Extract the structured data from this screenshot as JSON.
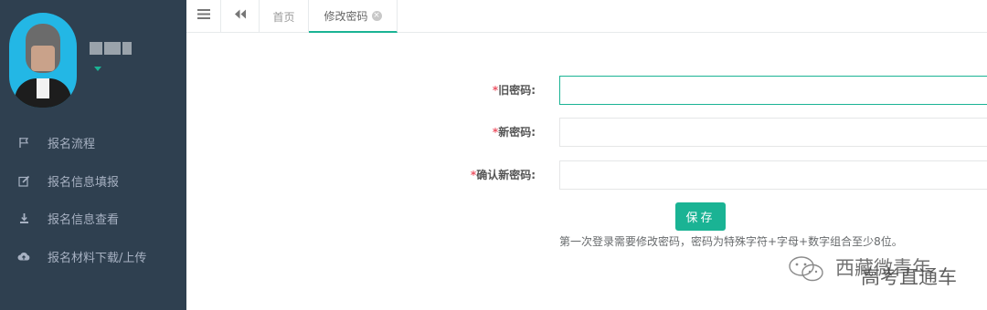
{
  "sidebar": {
    "menu": [
      {
        "icon": "flag-icon",
        "label": "报名流程"
      },
      {
        "icon": "edit-icon",
        "label": "报名信息填报"
      },
      {
        "icon": "download-icon",
        "label": "报名信息查看"
      },
      {
        "icon": "cloud-upload-icon",
        "label": "报名材料下载/上传"
      }
    ]
  },
  "topbar": {
    "menu_icon": "hamburger-icon",
    "back_icon": "double-back-icon",
    "tabs": [
      {
        "label": "首页"
      },
      {
        "label": "修改密码",
        "close_icon": "close-circle-icon"
      }
    ]
  },
  "form": {
    "required_mark": "*",
    "old_password_label": "旧密码:",
    "new_password_label": "新密码:",
    "confirm_password_label": "确认新密码:",
    "old_password_value": "",
    "new_password_value": "",
    "confirm_password_value": "",
    "save_label": "保存",
    "hint": "第一次登录需要修改密码，密码为特殊字符+字母+数字组合至少8位。"
  },
  "watermark": {
    "line1": "西藏微青年",
    "line2": "高考直通车"
  },
  "colors": {
    "sidebar_bg": "#2f4050",
    "accent": "#1ab394",
    "required": "#ed5565",
    "avatar_ring": "#23b7e5"
  }
}
